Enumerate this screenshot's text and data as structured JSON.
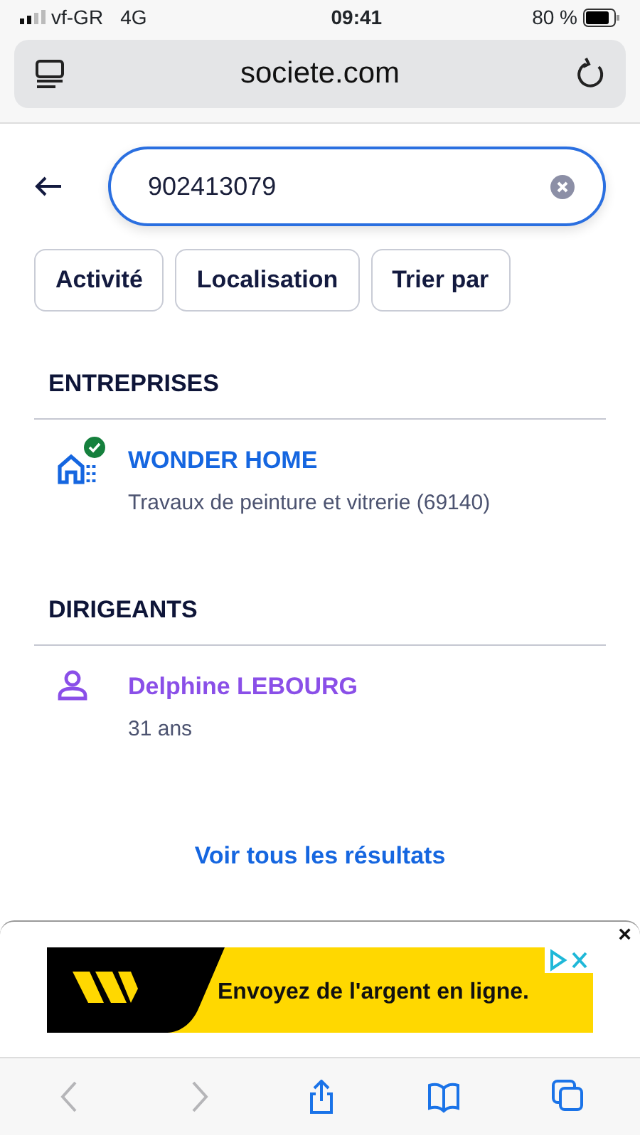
{
  "status_bar": {
    "carrier": "vf-GR",
    "network": "4G",
    "time": "09:41",
    "battery": "80 %"
  },
  "address_bar": {
    "url": "societe.com"
  },
  "search": {
    "value": "902413079"
  },
  "filters": [
    "Activité",
    "Localisation",
    "Trier par"
  ],
  "sections": [
    {
      "title": "ENTREPRISES",
      "kind": "company",
      "items": [
        {
          "name": "WONDER HOME",
          "detail": "Travaux de peinture et vitrerie (69140)",
          "verified": true
        }
      ]
    },
    {
      "title": "DIRIGEANTS",
      "kind": "person",
      "items": [
        {
          "name": "Delphine LEBOURG",
          "detail": "31 ans"
        }
      ]
    }
  ],
  "see_all": "Voir tous les résultats",
  "ad": {
    "text": "Envoyez de l'argent en ligne.",
    "close": "×"
  },
  "toolbar": [
    {
      "kind": "back",
      "disabled": true
    },
    {
      "kind": "forward",
      "disabled": true
    },
    {
      "kind": "share",
      "disabled": false
    },
    {
      "kind": "bookmarks",
      "disabled": false
    },
    {
      "kind": "tabs",
      "disabled": false
    }
  ]
}
